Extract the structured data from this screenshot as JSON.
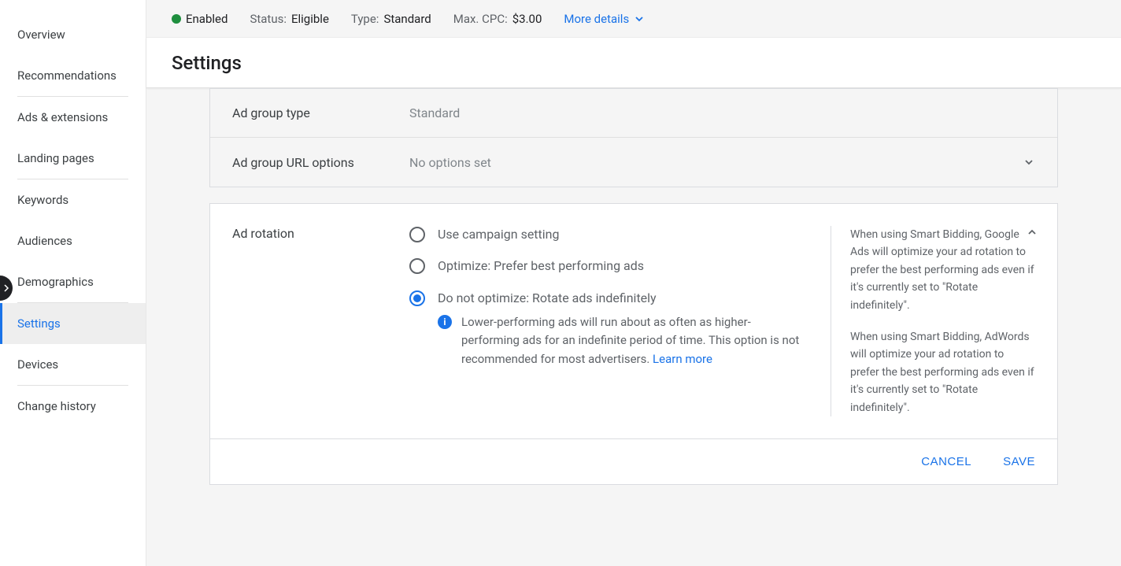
{
  "sidebar": {
    "items": [
      {
        "label": "Overview"
      },
      {
        "label": "Recommendations"
      },
      {
        "label": "Ads & extensions"
      },
      {
        "label": "Landing pages"
      },
      {
        "label": "Keywords"
      },
      {
        "label": "Audiences"
      },
      {
        "label": "Demographics"
      },
      {
        "label": "Settings"
      },
      {
        "label": "Devices"
      },
      {
        "label": "Change history"
      }
    ],
    "active_index": 7
  },
  "statusbar": {
    "enabled_label": "Enabled",
    "status_label": "Status:",
    "status_value": "Eligible",
    "type_label": "Type:",
    "type_value": "Standard",
    "max_cpc_label": "Max. CPC:",
    "max_cpc_value": "$3.00",
    "more_details": "More details"
  },
  "page_title": "Settings",
  "collapsed_rows": {
    "ad_group_type": {
      "label": "Ad group type",
      "value": "Standard"
    },
    "url_options": {
      "label": "Ad group URL options",
      "value": "No options set"
    }
  },
  "ad_rotation": {
    "section_label": "Ad rotation",
    "options": [
      {
        "label": "Use campaign setting"
      },
      {
        "label": "Optimize: Prefer best performing ads"
      },
      {
        "label": "Do not optimize: Rotate ads indefinitely"
      }
    ],
    "selected_index": 2,
    "info_text": "Lower-performing ads will run about as often as higher-performing ads for an indefinite period of time. This option is not recommended for most advertisers. ",
    "learn_more": "Learn more",
    "side_p1": "When using Smart Bidding, Google Ads will optimize your ad rotation to prefer the best performing ads even if it's currently set to \"Rotate indefinitely\".",
    "side_p2": "When using Smart Bidding, AdWords will optimize your ad rotation to prefer the best performing ads even if it's currently set to \"Rotate indefinitely\"."
  },
  "actions": {
    "cancel": "CANCEL",
    "save": "SAVE"
  }
}
